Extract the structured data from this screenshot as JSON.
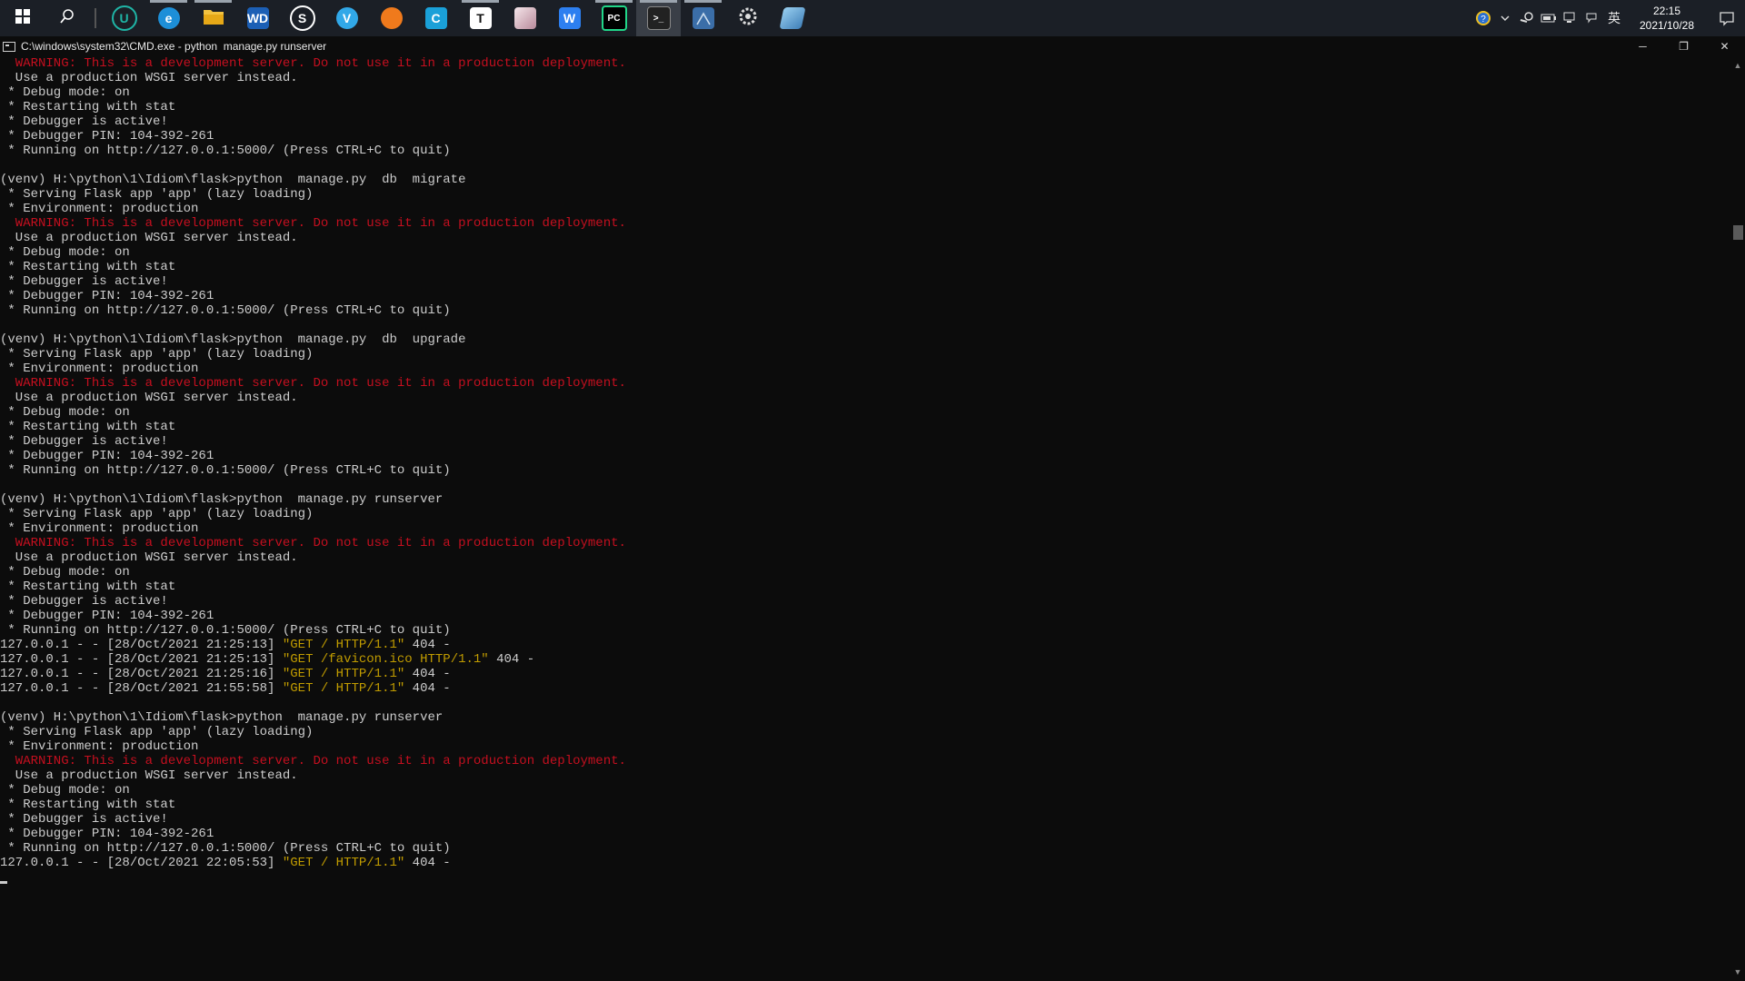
{
  "taskbar": {
    "apps": [
      {
        "name": "start-button",
        "icon": "windows-logo-icon",
        "open": false,
        "active": false
      },
      {
        "name": "search-button",
        "icon": "search-icon",
        "open": false,
        "active": false
      },
      {
        "name": "app-u",
        "icon": "u-circle-icon",
        "label": "U",
        "color": "#1fb5a6",
        "open": false,
        "active": false
      },
      {
        "name": "app-edge",
        "icon": "edge-icon",
        "label": "e",
        "color": "#1d8fd8",
        "open": true,
        "active": false
      },
      {
        "name": "app-file-explorer",
        "icon": "folder-icon",
        "label": "",
        "color": "#f3c23f",
        "open": true,
        "active": false
      },
      {
        "name": "app-wd",
        "icon": "wd-icon",
        "label": "WD",
        "color": "#1c5fb5",
        "open": false,
        "active": false
      },
      {
        "name": "app-steam",
        "icon": "steam-icon",
        "label": "S",
        "color": "#ffffff",
        "open": false,
        "active": false
      },
      {
        "name": "app-v",
        "icon": "v-circle-icon",
        "label": "V",
        "color": "#31a8e8",
        "open": false,
        "active": false
      },
      {
        "name": "app-orange",
        "icon": "orange-circle-icon",
        "label": "",
        "color": "#f07a1c",
        "open": false,
        "active": false
      },
      {
        "name": "app-c",
        "icon": "c-square-icon",
        "label": "C",
        "color": "#1aa0d8",
        "open": false,
        "active": false
      },
      {
        "name": "app-typora",
        "icon": "t-square-icon",
        "label": "T",
        "color": "#ffffff",
        "open": true,
        "active": false
      },
      {
        "name": "app-avatar",
        "icon": "anime-avatar-icon",
        "label": "",
        "color": "#d9b3c0",
        "open": false,
        "active": false
      },
      {
        "name": "app-wps",
        "icon": "w-square-icon",
        "label": "W",
        "color": "#2d7ff0",
        "open": false,
        "active": false
      },
      {
        "name": "app-pycharm",
        "icon": "pycharm-icon",
        "label": "PC",
        "color": "#21d789",
        "open": true,
        "active": false
      },
      {
        "name": "app-cmd",
        "icon": "terminal-icon",
        "label": ">_",
        "color": "#2b2b2b",
        "open": true,
        "active": true
      },
      {
        "name": "app-database",
        "icon": "database-icon",
        "label": "",
        "color": "#3b6ea8",
        "open": true,
        "active": false
      },
      {
        "name": "app-settings",
        "icon": "gear-icon",
        "label": "",
        "color": "#dddddd",
        "open": false,
        "active": false
      },
      {
        "name": "app-blue-doc",
        "icon": "blue-doc-icon",
        "label": "",
        "color": "#6ab0de",
        "open": false,
        "active": false
      }
    ],
    "tray": {
      "icons": [
        "help-circle-icon",
        "chevron-up-icon",
        "steam-tray-icon",
        "battery-icon",
        "network-icon",
        "keyboard-icon"
      ],
      "ime": "英",
      "time": "22:15",
      "date": "2021/10/28"
    }
  },
  "window": {
    "title": "C:\\windows\\system32\\CMD.exe - python  manage.py runserver",
    "controls": {
      "minimize": "─",
      "restore": "❐",
      "close": "✕"
    }
  },
  "console": {
    "colors": {
      "default": "#cccccc",
      "red": "#c50f1f",
      "yellow": "#c19c00",
      "background": "#0c0c0c"
    },
    "lines": [
      [
        {
          "t": "  WARNING: This is a development server. Do not use it in a production deployment.",
          "c": "red"
        }
      ],
      [
        {
          "t": "  Use a production WSGI server instead.",
          "c": "default"
        }
      ],
      [
        {
          "t": " * Debug mode: on",
          "c": "default"
        }
      ],
      [
        {
          "t": " * Restarting with stat",
          "c": "default"
        }
      ],
      [
        {
          "t": " * Debugger is active!",
          "c": "default"
        }
      ],
      [
        {
          "t": " * Debugger PIN: 104-392-261",
          "c": "default"
        }
      ],
      [
        {
          "t": " * Running on http://127.0.0.1:5000/ (Press CTRL+C to quit)",
          "c": "default"
        }
      ],
      [],
      [
        {
          "t": "(venv) H:\\python\\1\\Idiom\\flask>python  manage.py  db  migrate",
          "c": "default"
        }
      ],
      [
        {
          "t": " * Serving Flask app 'app' (lazy loading)",
          "c": "default"
        }
      ],
      [
        {
          "t": " * Environment: production",
          "c": "default"
        }
      ],
      [
        {
          "t": "  WARNING: This is a development server. Do not use it in a production deployment.",
          "c": "red"
        }
      ],
      [
        {
          "t": "  Use a production WSGI server instead.",
          "c": "default"
        }
      ],
      [
        {
          "t": " * Debug mode: on",
          "c": "default"
        }
      ],
      [
        {
          "t": " * Restarting with stat",
          "c": "default"
        }
      ],
      [
        {
          "t": " * Debugger is active!",
          "c": "default"
        }
      ],
      [
        {
          "t": " * Debugger PIN: 104-392-261",
          "c": "default"
        }
      ],
      [
        {
          "t": " * Running on http://127.0.0.1:5000/ (Press CTRL+C to quit)",
          "c": "default"
        }
      ],
      [],
      [
        {
          "t": "(venv) H:\\python\\1\\Idiom\\flask>python  manage.py  db  upgrade",
          "c": "default"
        }
      ],
      [
        {
          "t": " * Serving Flask app 'app' (lazy loading)",
          "c": "default"
        }
      ],
      [
        {
          "t": " * Environment: production",
          "c": "default"
        }
      ],
      [
        {
          "t": "  WARNING: This is a development server. Do not use it in a production deployment.",
          "c": "red"
        }
      ],
      [
        {
          "t": "  Use a production WSGI server instead.",
          "c": "default"
        }
      ],
      [
        {
          "t": " * Debug mode: on",
          "c": "default"
        }
      ],
      [
        {
          "t": " * Restarting with stat",
          "c": "default"
        }
      ],
      [
        {
          "t": " * Debugger is active!",
          "c": "default"
        }
      ],
      [
        {
          "t": " * Debugger PIN: 104-392-261",
          "c": "default"
        }
      ],
      [
        {
          "t": " * Running on http://127.0.0.1:5000/ (Press CTRL+C to quit)",
          "c": "default"
        }
      ],
      [],
      [
        {
          "t": "(venv) H:\\python\\1\\Idiom\\flask>python  manage.py runserver",
          "c": "default"
        }
      ],
      [
        {
          "t": " * Serving Flask app 'app' (lazy loading)",
          "c": "default"
        }
      ],
      [
        {
          "t": " * Environment: production",
          "c": "default"
        }
      ],
      [
        {
          "t": "  WARNING: This is a development server. Do not use it in a production deployment.",
          "c": "red"
        }
      ],
      [
        {
          "t": "  Use a production WSGI server instead.",
          "c": "default"
        }
      ],
      [
        {
          "t": " * Debug mode: on",
          "c": "default"
        }
      ],
      [
        {
          "t": " * Restarting with stat",
          "c": "default"
        }
      ],
      [
        {
          "t": " * Debugger is active!",
          "c": "default"
        }
      ],
      [
        {
          "t": " * Debugger PIN: 104-392-261",
          "c": "default"
        }
      ],
      [
        {
          "t": " * Running on http://127.0.0.1:5000/ (Press CTRL+C to quit)",
          "c": "default"
        }
      ],
      [
        {
          "t": "127.0.0.1 - - [28/Oct/2021 21:25:13] ",
          "c": "default"
        },
        {
          "t": "\"GET / HTTP/1.1\"",
          "c": "yellow"
        },
        {
          "t": " 404 -",
          "c": "default"
        }
      ],
      [
        {
          "t": "127.0.0.1 - - [28/Oct/2021 21:25:13] ",
          "c": "default"
        },
        {
          "t": "\"GET /favicon.ico HTTP/1.1\"",
          "c": "yellow"
        },
        {
          "t": " 404 -",
          "c": "default"
        }
      ],
      [
        {
          "t": "127.0.0.1 - - [28/Oct/2021 21:25:16] ",
          "c": "default"
        },
        {
          "t": "\"GET / HTTP/1.1\"",
          "c": "yellow"
        },
        {
          "t": " 404 -",
          "c": "default"
        }
      ],
      [
        {
          "t": "127.0.0.1 - - [28/Oct/2021 21:55:58] ",
          "c": "default"
        },
        {
          "t": "\"GET / HTTP/1.1\"",
          "c": "yellow"
        },
        {
          "t": " 404 -",
          "c": "default"
        }
      ],
      [],
      [
        {
          "t": "(venv) H:\\python\\1\\Idiom\\flask>python  manage.py runserver",
          "c": "default"
        }
      ],
      [
        {
          "t": " * Serving Flask app 'app' (lazy loading)",
          "c": "default"
        }
      ],
      [
        {
          "t": " * Environment: production",
          "c": "default"
        }
      ],
      [
        {
          "t": "  WARNING: This is a development server. Do not use it in a production deployment.",
          "c": "red"
        }
      ],
      [
        {
          "t": "  Use a production WSGI server instead.",
          "c": "default"
        }
      ],
      [
        {
          "t": " * Debug mode: on",
          "c": "default"
        }
      ],
      [
        {
          "t": " * Restarting with stat",
          "c": "default"
        }
      ],
      [
        {
          "t": " * Debugger is active!",
          "c": "default"
        }
      ],
      [
        {
          "t": " * Debugger PIN: 104-392-261",
          "c": "default"
        }
      ],
      [
        {
          "t": " * Running on http://127.0.0.1:5000/ (Press CTRL+C to quit)",
          "c": "default"
        }
      ],
      [
        {
          "t": "127.0.0.1 - - [28/Oct/2021 22:05:53] ",
          "c": "default"
        },
        {
          "t": "\"GET / HTTP/1.1\"",
          "c": "yellow"
        },
        {
          "t": " 404 -",
          "c": "default"
        }
      ]
    ]
  }
}
